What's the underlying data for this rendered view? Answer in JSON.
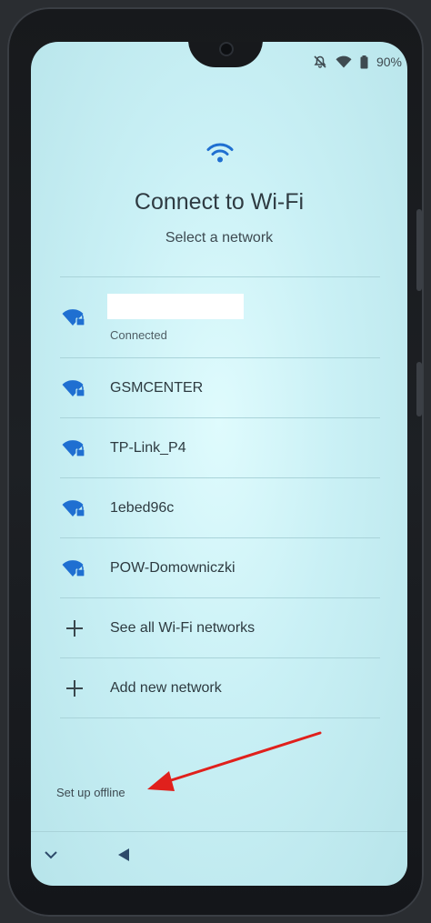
{
  "status_bar": {
    "battery": "90%",
    "icons": [
      "muted-bell-icon",
      "wifi-icon",
      "battery-icon"
    ]
  },
  "header": {
    "icon": "wifi-icon",
    "title": "Connect to Wi-Fi",
    "subtitle": "Select a network"
  },
  "networks": [
    {
      "name": "",
      "status": "Connected",
      "icon": "wifi-lock-icon"
    },
    {
      "name": "GSMCENTER",
      "icon": "wifi-lock-icon"
    },
    {
      "name": "TP-Link_P4",
      "icon": "wifi-lock-icon"
    },
    {
      "name": "1ebed96c",
      "icon": "wifi-lock-icon"
    },
    {
      "name": "POW-Domowniczki",
      "icon": "wifi-lock-icon"
    }
  ],
  "actions": {
    "see_all": "See all Wi-Fi networks",
    "add_new": "Add new network"
  },
  "footer": {
    "offline_label": "Set up offline"
  },
  "annotation": {
    "arrow_color": "#e0201c"
  },
  "colors": {
    "background": "#c9f0f5",
    "text": "#2f3b42",
    "icon_blue": "#1f6fd1"
  }
}
